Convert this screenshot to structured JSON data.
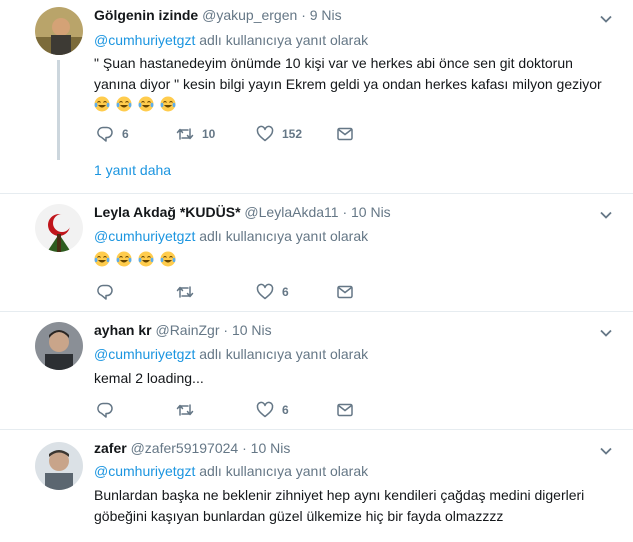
{
  "reply_prefix": "adlı kullanıcıya yanıt olarak",
  "tweets": [
    {
      "name": "Gölgenin izinde",
      "handle": "@yakup_ergen",
      "dot": "·",
      "time": "9 Nis",
      "reply_to": "@cumhuriyetgzt",
      "text_line1": "\" Şuan hastanedeyim önümde 10 kişi var ve herkes abi önce sen git doktorun",
      "text_line2": "yanına diyor \" kesin bilgi yayın Ekrem geldi ya ondan herkes kafası milyon geziyor",
      "emoji_count": 4,
      "reply_count": "6",
      "retweet_count": "10",
      "like_count": "152",
      "show_replies": "1 yanıt daha"
    },
    {
      "name": "Leyla Akdağ *KUDÜS*",
      "handle": "@LeylaAkda11",
      "dot": "·",
      "time": "10 Nis",
      "reply_to": "@cumhuriyetgzt",
      "emoji_count": 4,
      "reply_count": "",
      "retweet_count": "",
      "like_count": "6"
    },
    {
      "name": "ayhan kr",
      "handle": "@RainZgr",
      "dot": "·",
      "time": "10 Nis",
      "reply_to": "@cumhuriyetgzt",
      "text_line1": "kemal 2 loading...",
      "reply_count": "",
      "retweet_count": "",
      "like_count": "6"
    },
    {
      "name": "zafer",
      "handle": "@zafer59197024",
      "dot": "·",
      "time": "10 Nis",
      "reply_to": "@cumhuriyetgzt",
      "text_line1": "Bunlardan başka ne beklenir zihniyet hep aynı kendileri çağdaş medini digerleri",
      "text_line2": "göbeğini kaşıyan bunlardan güzel ülkemize hiç bir fayda olmazzzz"
    }
  ],
  "colors": {
    "link": "#1b95e0",
    "muted": "#657786",
    "border": "#e6ecf0",
    "thread": "#ccd6dd"
  },
  "icons": [
    "reply-icon",
    "retweet-icon",
    "like-icon",
    "message-icon",
    "chevron-down-icon",
    "laughing-tears-emoji"
  ]
}
